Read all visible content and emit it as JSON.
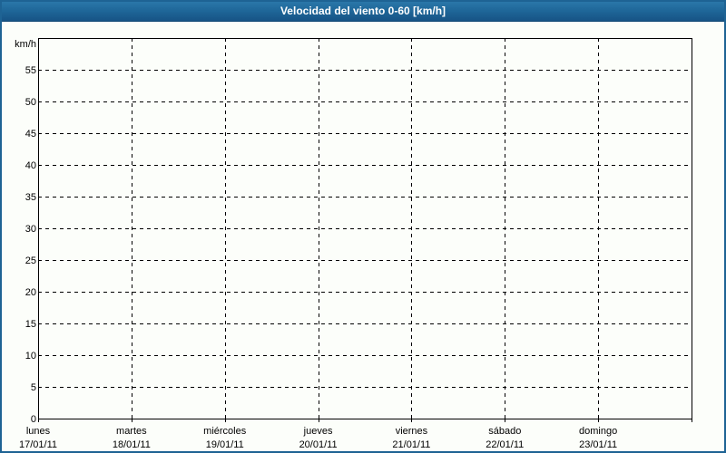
{
  "header": {
    "title": "Velocidad del viento 0-60 [km/h]",
    "background_color": "#1d6496",
    "text_color": "#ffffff"
  },
  "window": {
    "background_color": "#fcfefa",
    "border_color": "#1e6394"
  },
  "chart_data": {
    "type": "line",
    "title": "Velocidad del viento 0-60 [km/h]",
    "ylabel": "km/h",
    "ylim": [
      0,
      60
    ],
    "y_tick_step": 5,
    "y_tick_labels": [
      "0",
      "5",
      "10",
      "15",
      "20",
      "25",
      "30",
      "35",
      "40",
      "45",
      "50",
      "55"
    ],
    "x_categories": [
      {
        "day": "lunes",
        "date": "17/01/11"
      },
      {
        "day": "martes",
        "date": "18/01/11"
      },
      {
        "day": "miércoles",
        "date": "19/01/11"
      },
      {
        "day": "jueves",
        "date": "20/01/11"
      },
      {
        "day": "viernes",
        "date": "21/01/11"
      },
      {
        "day": "sábado",
        "date": "22/01/11"
      },
      {
        "day": "domingo",
        "date": "23/01/11"
      }
    ],
    "series": [],
    "grid": {
      "style": "dashed",
      "color": "#000000"
    },
    "axis_color": "#000000",
    "legend": "none"
  }
}
